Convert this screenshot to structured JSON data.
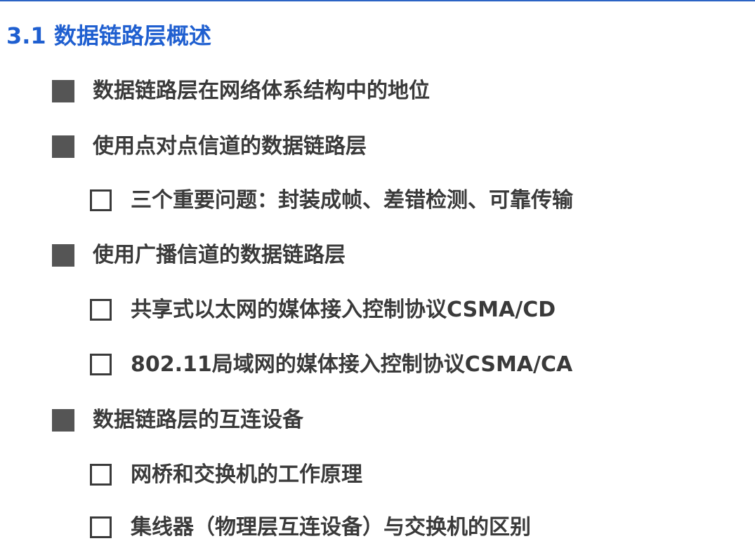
{
  "slide": {
    "title": "3.1 数据链路层概述",
    "accent_color": "#1f5fd0"
  },
  "items": [
    {
      "level": 1,
      "bullet": "filled-square-icon",
      "text": "数据链路层在网络体系结构中的地位"
    },
    {
      "level": 1,
      "bullet": "filled-square-icon",
      "text": "使用点对点信道的数据链路层"
    },
    {
      "level": 2,
      "bullet": "hollow-square-icon",
      "text": "三个重要问题：封装成帧、差错检测、可靠传输"
    },
    {
      "level": 1,
      "bullet": "filled-square-icon",
      "text": "使用广播信道的数据链路层"
    },
    {
      "level": 2,
      "bullet": "hollow-square-icon",
      "text": "共享式以太网的媒体接入控制协议CSMA/CD"
    },
    {
      "level": 2,
      "bullet": "hollow-square-icon",
      "text": "802.11局域网的媒体接入控制协议CSMA/CA"
    },
    {
      "level": 1,
      "bullet": "filled-square-icon",
      "text": "数据链路层的互连设备"
    },
    {
      "level": 2,
      "bullet": "hollow-square-icon",
      "text": "网桥和交换机的工作原理"
    },
    {
      "level": 2,
      "bullet": "hollow-square-icon",
      "text": "集线器（物理层互连设备）与交换机的区别"
    }
  ]
}
